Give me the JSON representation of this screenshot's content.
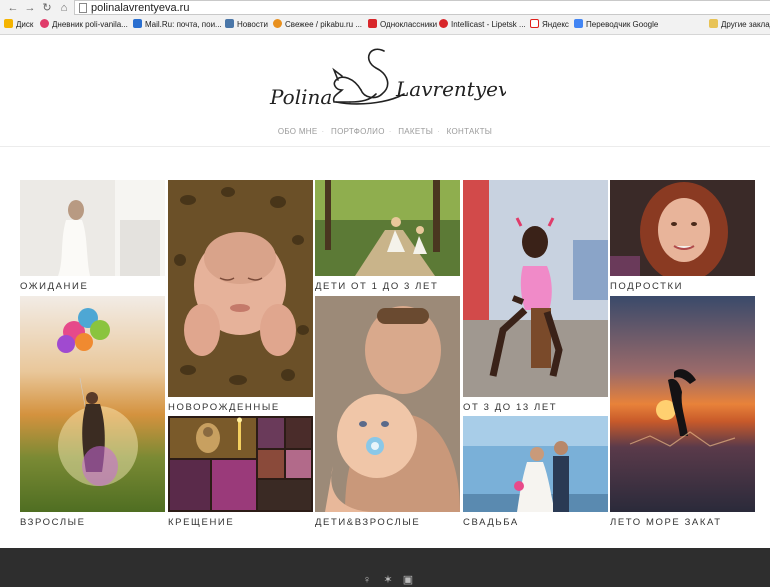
{
  "browser": {
    "url": "polinalavrentyeva.ru",
    "bookmarks": [
      {
        "label": "Диск",
        "color": "#f5b400"
      },
      {
        "label": "Дневник poli-vanila...",
        "color": "#e03c6a"
      },
      {
        "label": "Mail.Ru: почта, пои...",
        "color": "#2a6fd0"
      },
      {
        "label": "Новости",
        "color": "#4a76a8"
      },
      {
        "label": "Свежее / pikabu.ru ...",
        "color": "#e8901e"
      },
      {
        "label": "Одноклассники",
        "color": "#d8262a"
      },
      {
        "label": "Intellicast - Lipetsk ...",
        "color": "#d8262a"
      },
      {
        "label": "Яндекс",
        "color": "#e0201b"
      },
      {
        "label": "Переводчик Google",
        "color": "#4285f4"
      },
      {
        "label": "Другие заклад",
        "color": "#e8c356"
      }
    ]
  },
  "site": {
    "logo_first": "Polina",
    "logo_second": "Lavrentyeva",
    "nav": [
      "ОБО МНЕ",
      "ПОРТФОЛИО",
      "ПАКЕТЫ",
      "КОНТАКТЫ"
    ]
  },
  "gallery": {
    "labels": {
      "ozhidanie": "ОЖИДАНИЕ",
      "vzroslye": "ВЗРОСЛЫЕ",
      "novorozhdennye": "НОВОРОЖДЕННЫЕ",
      "kreshchenie": "КРЕЩЕНИЕ",
      "deti13": "ДЕТИ ОТ 1 ДО 3 ЛЕТ",
      "detivzroslye": "ДЕТИ&ВЗРОСЛЫЕ",
      "ot313": "ОТ 3 ДО 13 ЛЕТ",
      "svadba": "СВАДЬБА",
      "podrostki": "ПОДРОСТКИ",
      "leto": "ЛЕТО МОРЕ ЗАКАТ"
    }
  },
  "footer": {
    "icons": [
      "person-icon",
      "vk-icon",
      "instagram-icon"
    ]
  }
}
